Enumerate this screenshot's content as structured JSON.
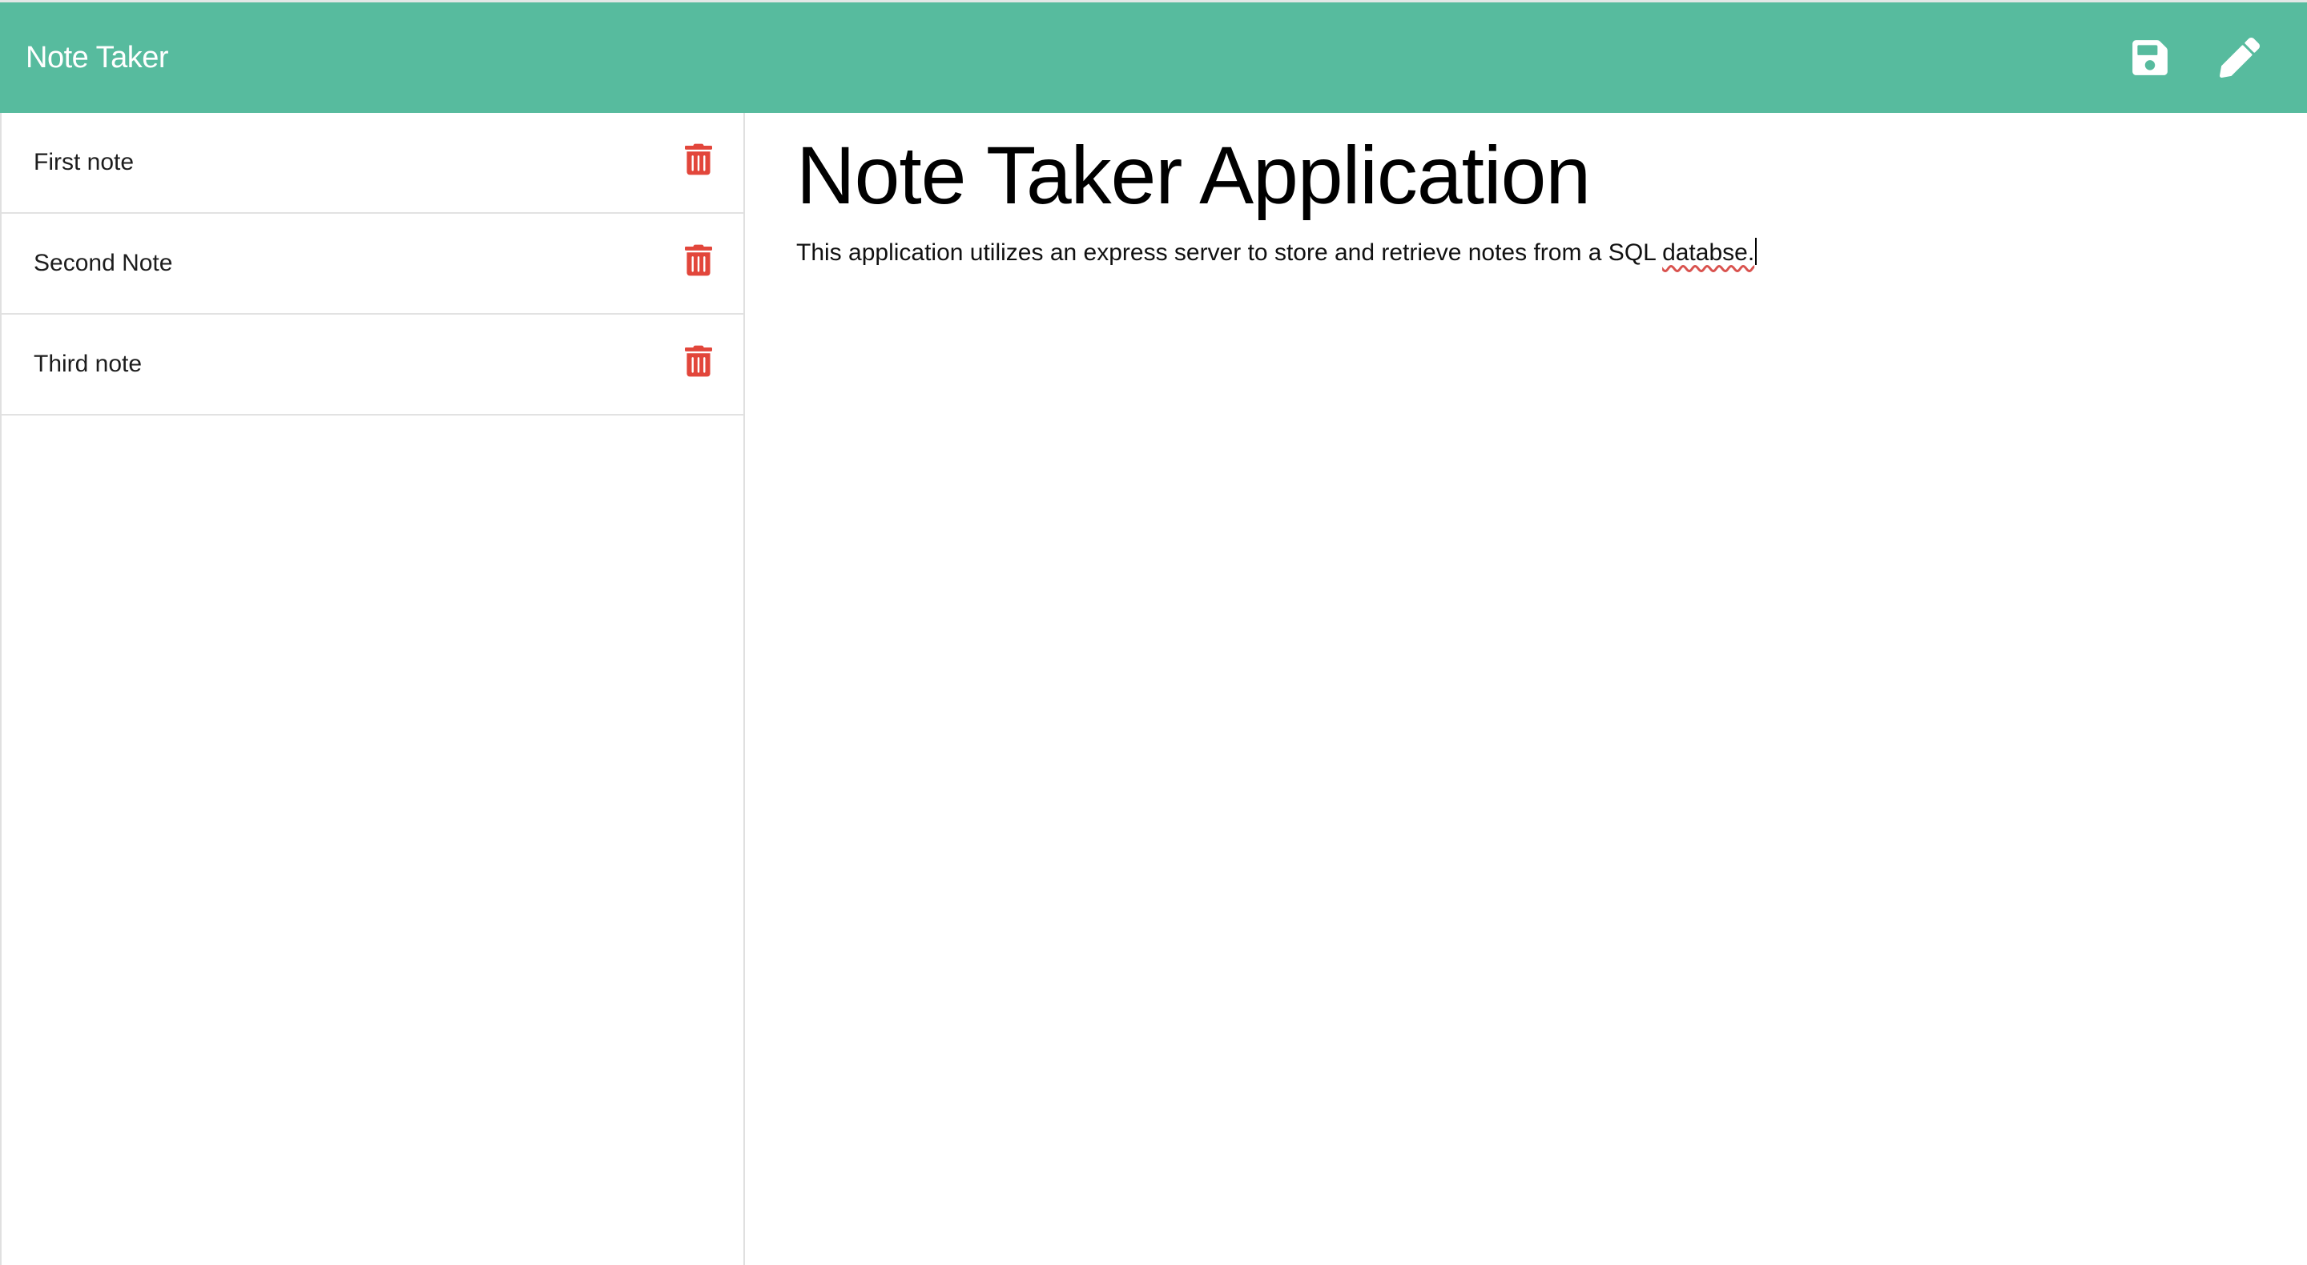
{
  "app": {
    "title": "Note Taker",
    "brand_color": "#57bb9e",
    "accent_delete_color": "#e2463b"
  },
  "toolbar": {
    "save_icon": "save-icon",
    "new_note_icon": "pencil-icon"
  },
  "sidebar": {
    "items": [
      {
        "label": "First note",
        "icon": "trash-icon"
      },
      {
        "label": "Second Note",
        "icon": "trash-icon"
      },
      {
        "label": "Third note",
        "icon": "trash-icon"
      }
    ]
  },
  "note": {
    "title": "Note Taker Application",
    "body_prefix": "This application utilizes an express server to store and retrieve notes from a SQL ",
    "body_misspelled_word": "databse.",
    "body": "This application utilizes an express server to store and retrieve notes from a SQL databse."
  }
}
